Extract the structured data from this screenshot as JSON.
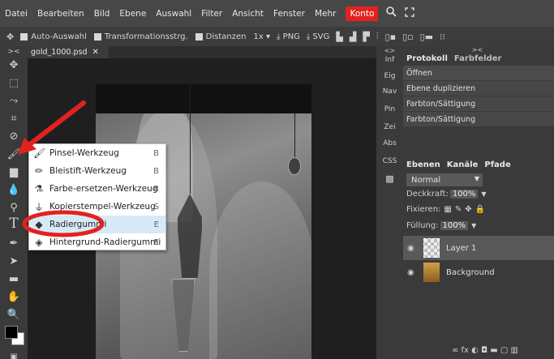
{
  "menubar": {
    "items": [
      "Datei",
      "Bearbeiten",
      "Bild",
      "Ebene",
      "Auswahl",
      "Filter",
      "Ansicht",
      "Fenster",
      "Mehr"
    ],
    "account": "Konto",
    "icons": [
      "search-icon",
      "fullscreen-icon"
    ]
  },
  "options": {
    "auto_select": "Auto-Auswahl",
    "transform": "Transformationsstrg.",
    "distances": "Distanzen",
    "zoom": "1x",
    "png": "PNG",
    "svg": "SVG"
  },
  "document": {
    "tab_name": "gold_1000.psd",
    "close": "✕"
  },
  "panel_column": [
    "Inf",
    "Eig",
    "Nav",
    "Pin",
    "Zei",
    "Abs",
    "CSS"
  ],
  "history": {
    "tabs": [
      "Protokoll",
      "Farbfelder"
    ],
    "rows": [
      "Öffnen",
      "Ebene duplizieren",
      "Farbton/Sättigung",
      "Farbton/Sättigung"
    ]
  },
  "layers": {
    "tabs": [
      "Ebenen",
      "Kanäle",
      "Pfade"
    ],
    "blend_mode": "Normal",
    "opacity_label": "Deckkraft:",
    "opacity_value": "100%",
    "lock_label": "Fixieren:",
    "fill_label": "Füllung:",
    "fill_value": "100%",
    "rows": [
      {
        "name": "Layer 1",
        "active": true
      },
      {
        "name": "Background",
        "active": false
      }
    ]
  },
  "flyout": {
    "items": [
      {
        "label": "Pinsel-Werkzeug",
        "key": "B",
        "icon": "brush-icon"
      },
      {
        "label": "Bleistift-Werkzeug",
        "key": "B",
        "icon": "pencil-icon"
      },
      {
        "label": "Farbe-ersetzen-Werkzeug",
        "key": "B",
        "icon": "color-replace-icon"
      },
      {
        "label": "Kopierstempel-Werkzeug",
        "key": "S",
        "icon": "clone-stamp-icon"
      },
      {
        "label": "Radiergummi",
        "key": "E",
        "icon": "eraser-icon"
      },
      {
        "label": "Hintergrund-Radiergummi",
        "key": "E",
        "icon": "background-eraser-icon"
      }
    ],
    "selected_index": 4
  },
  "colors": {
    "annotation": "#e2221f",
    "konto": "#e2221f",
    "foreground": "#000000",
    "background": "#ffffff"
  }
}
